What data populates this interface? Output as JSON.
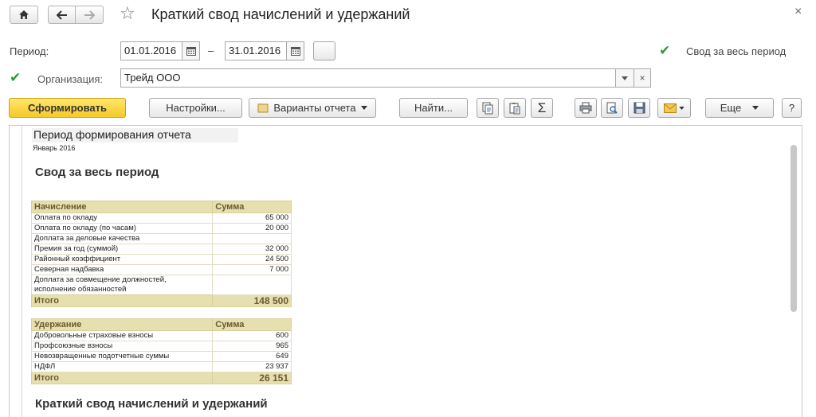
{
  "window": {
    "title": "Краткий свод начислений и удержаний",
    "close_glyph": "×"
  },
  "form": {
    "period_label": "Период:",
    "date_from": "01.01.2016",
    "dash": "–",
    "date_to": "31.01.2016",
    "period_picker_label": "...",
    "whole_period_label": "Свод за весь период",
    "whole_period_checked": true,
    "org_label": "Организация:",
    "org_checked": true,
    "org_value": "Трейд ООО"
  },
  "toolbar": {
    "generate_label": "Сформировать",
    "settings_label": "Настройки...",
    "variants_label": "Варианты отчета",
    "find_label": "Найти...",
    "sum_glyph": "Σ",
    "more_label": "Еще",
    "help_label": "?"
  },
  "report": {
    "period_title": "Период формирования отчета",
    "period_value": "Январь 2016",
    "summary_heading": "Свод за весь период",
    "accruals": {
      "headers": [
        "Начисление",
        "Сумма"
      ],
      "rows": [
        {
          "name": "Оплата по окладу",
          "amount": "65 000"
        },
        {
          "name": "Оплата по окладу (по часам)",
          "amount": "20 000"
        },
        {
          "name": "Доплата за деловые качества",
          "amount": ""
        },
        {
          "name": "Премия за год (суммой)",
          "amount": "32 000"
        },
        {
          "name": "Районный коэффициент",
          "amount": "24 500"
        },
        {
          "name": "Северная надбавка",
          "amount": "7 000"
        },
        {
          "name": "Доплата за совмещение должностей,",
          "amount": ""
        },
        {
          "name": "исполнение обязанностей",
          "amount": ""
        }
      ],
      "total_label": "Итого",
      "total_value": "148 500"
    },
    "deductions": {
      "headers": [
        "Удержание",
        "Сумма"
      ],
      "rows": [
        {
          "name": "Добровольные страховые взносы",
          "amount": "600"
        },
        {
          "name": "Профсоюзные взносы",
          "amount": "965"
        },
        {
          "name": "Невозвращенные подотчетные суммы",
          "amount": "649"
        },
        {
          "name": "НДФЛ",
          "amount": "23 937"
        }
      ],
      "total_label": "Итого",
      "total_value": "26 151"
    },
    "second_heading": "Краткий свод начислений и удержаний"
  },
  "colors": {
    "primary_button": "#f5c92b",
    "table_header": "#e6dfb0",
    "checkmark": "#2f9a2f"
  },
  "icons": [
    "home-icon",
    "back-arrow-icon",
    "forward-arrow-icon",
    "star-icon",
    "calendar-icon",
    "dropdown-arrow-icon",
    "clear-icon",
    "report-variants-icon",
    "copy-icon",
    "paste-icon",
    "sum-icon",
    "print-icon",
    "preview-icon",
    "save-icon",
    "mail-icon",
    "scrollbar"
  ]
}
